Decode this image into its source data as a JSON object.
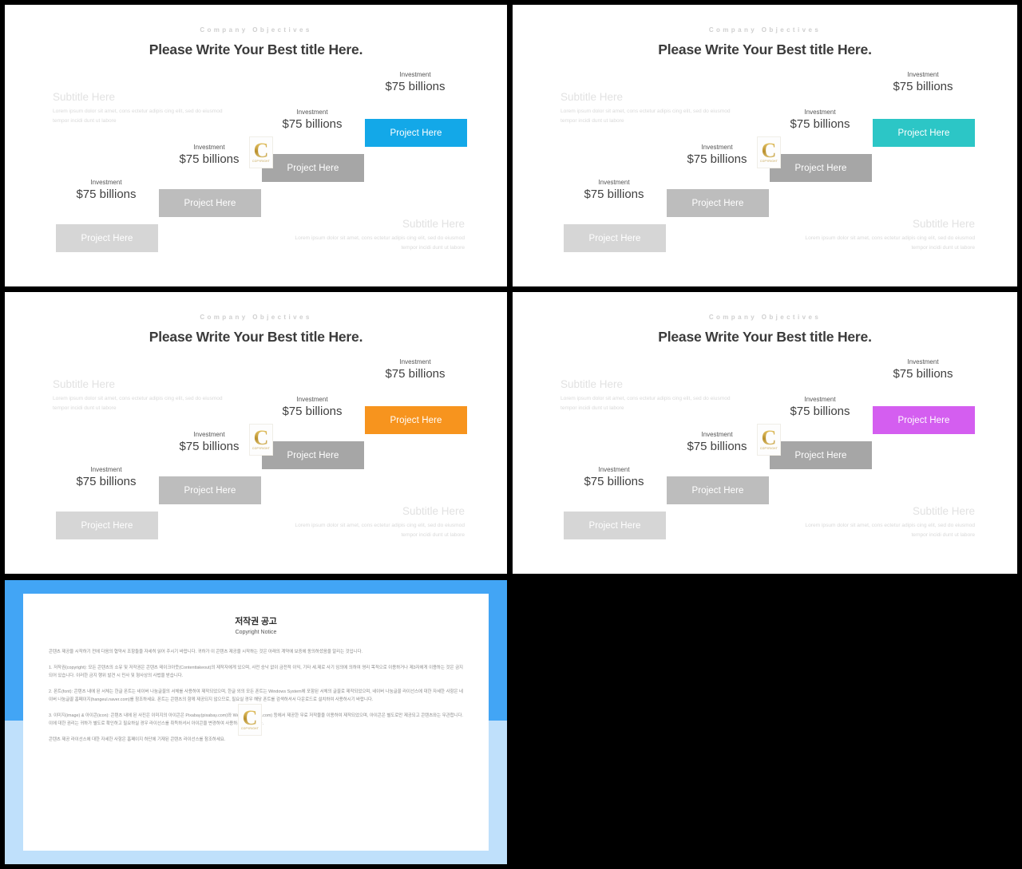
{
  "theme": {
    "background": "#000000",
    "slide_background": "#ffffff",
    "step_grays": [
      "#d6d6d6",
      "#bdbdbd",
      "#a6a6a6"
    ],
    "title_color": "#3b3b3b",
    "eyebrow_color": "#cfcfcf",
    "subtitle_color": "#e2e2e2"
  },
  "slide_common": {
    "eyebrow": "Company Objectives",
    "title": "Please Write Your Best title Here.",
    "subtitle_left": {
      "heading": "Subtitle Here",
      "body": "Lorem ipsum dolor sit amet, cons ectetur adipis cing elit, sed do eiusmod tempor incidi dunt ut labore"
    },
    "subtitle_right": {
      "heading": "Subtitle Here",
      "body": "Lorem ipsum dolor sit amet, cons ectetur adipis cing elit, sed do eiusmod tempor incidi dunt ut labore"
    },
    "steps": [
      {
        "label": "Project Here",
        "caption_label": "Investment",
        "caption_value": "$75 billions"
      },
      {
        "label": "Project Here",
        "caption_label": "Investment",
        "caption_value": "$75 billions"
      },
      {
        "label": "Project Here",
        "caption_label": "Investment",
        "caption_value": "$75 billions"
      },
      {
        "label": "Project Here",
        "caption_label": "Investment",
        "caption_value": "$75 billions"
      }
    ],
    "watermark": {
      "letter": "C",
      "sub": "COPYRIGHT"
    }
  },
  "slides": [
    {
      "name": "slide-blue",
      "accent": "#13a8e8"
    },
    {
      "name": "slide-teal",
      "accent": "#2cc6c6"
    },
    {
      "name": "slide-orange",
      "accent": "#f7941e"
    },
    {
      "name": "slide-purple",
      "accent": "#d45ef0"
    }
  ],
  "copyright": {
    "title": "저작권 공고",
    "subtitle": "Copyright Notice",
    "paragraphs": [
      "콘텐츠 제공을 시작하기 전에 다음의 협약서 조항들을 자세히 읽어 주시기 바랍니다. 귀하가 이 콘텐츠 제공을 시작하는 것은 아래의 계약에 보증에 동의하셨음을 알리는 것입니다.",
      "1. 저작권(copyright): 모든 콘텐츠의 소유 및 저작권은 콘텐츠 테이크아웃(Contenttakeout)의 제작자에게 있으며, 사전 승낙 없이 금전적 이익, 기타 세.제로 사기 임의에 의하여 영리 목적으로 이용하거나 제3자에게 이용하는 것은 금지되어 있습니다. 이러한 금지 행위 발견 시 민사 및 형사상의 사법을 받습니다.",
      "2. 폰트(font): 콘텐츠 내에 된 서체는 한글 폰트는 네이버 나눔글꼴의 서체를 사용하여 제작되었으며, 한글 외의 모든 폰트는 Windows System에 포함된 서체의 글꼴로 제작되었으며, 네이버 나눔글꼴 라이선스에 대한 자세한 사항은 네이버 나눔글꼴 홈페이지(hangeul.naver.com)를 참조하세요. 폰트는 콘텐츠의 함께 제공되지 않으므로, 필요실 경우 해당 폰트를 검색하셔서 다운로드로 설치하여 사용하시기 바랍니다.",
      "3. 이미지(image) & 아이콘(icon): 콘텐츠 내에 된 사진은 이미지의 아이콘은 Pixabay(pixabay.com)와 Weboly(weboly.com) 등에서 제공한 무료 저작물을 이용하여 제작되었으며, 아이콘은 별도로만 제공되고 콘텐츠와는 무관합니다. 이에 대한 권리는 귀하가 별도로 확인하고 필요하실 경우 라이선스를 취득하셔서 아이콘을 변경하여 사용하시기 바랍니다.",
      "콘텐츠 제공 라이선스에 대한 자세한 사항은 홈페이지 하단에 기재된 콘텐츠 라이선스를 참조하세요."
    ],
    "watermark": {
      "letter": "C",
      "sub": "COPYRIGHT"
    }
  }
}
